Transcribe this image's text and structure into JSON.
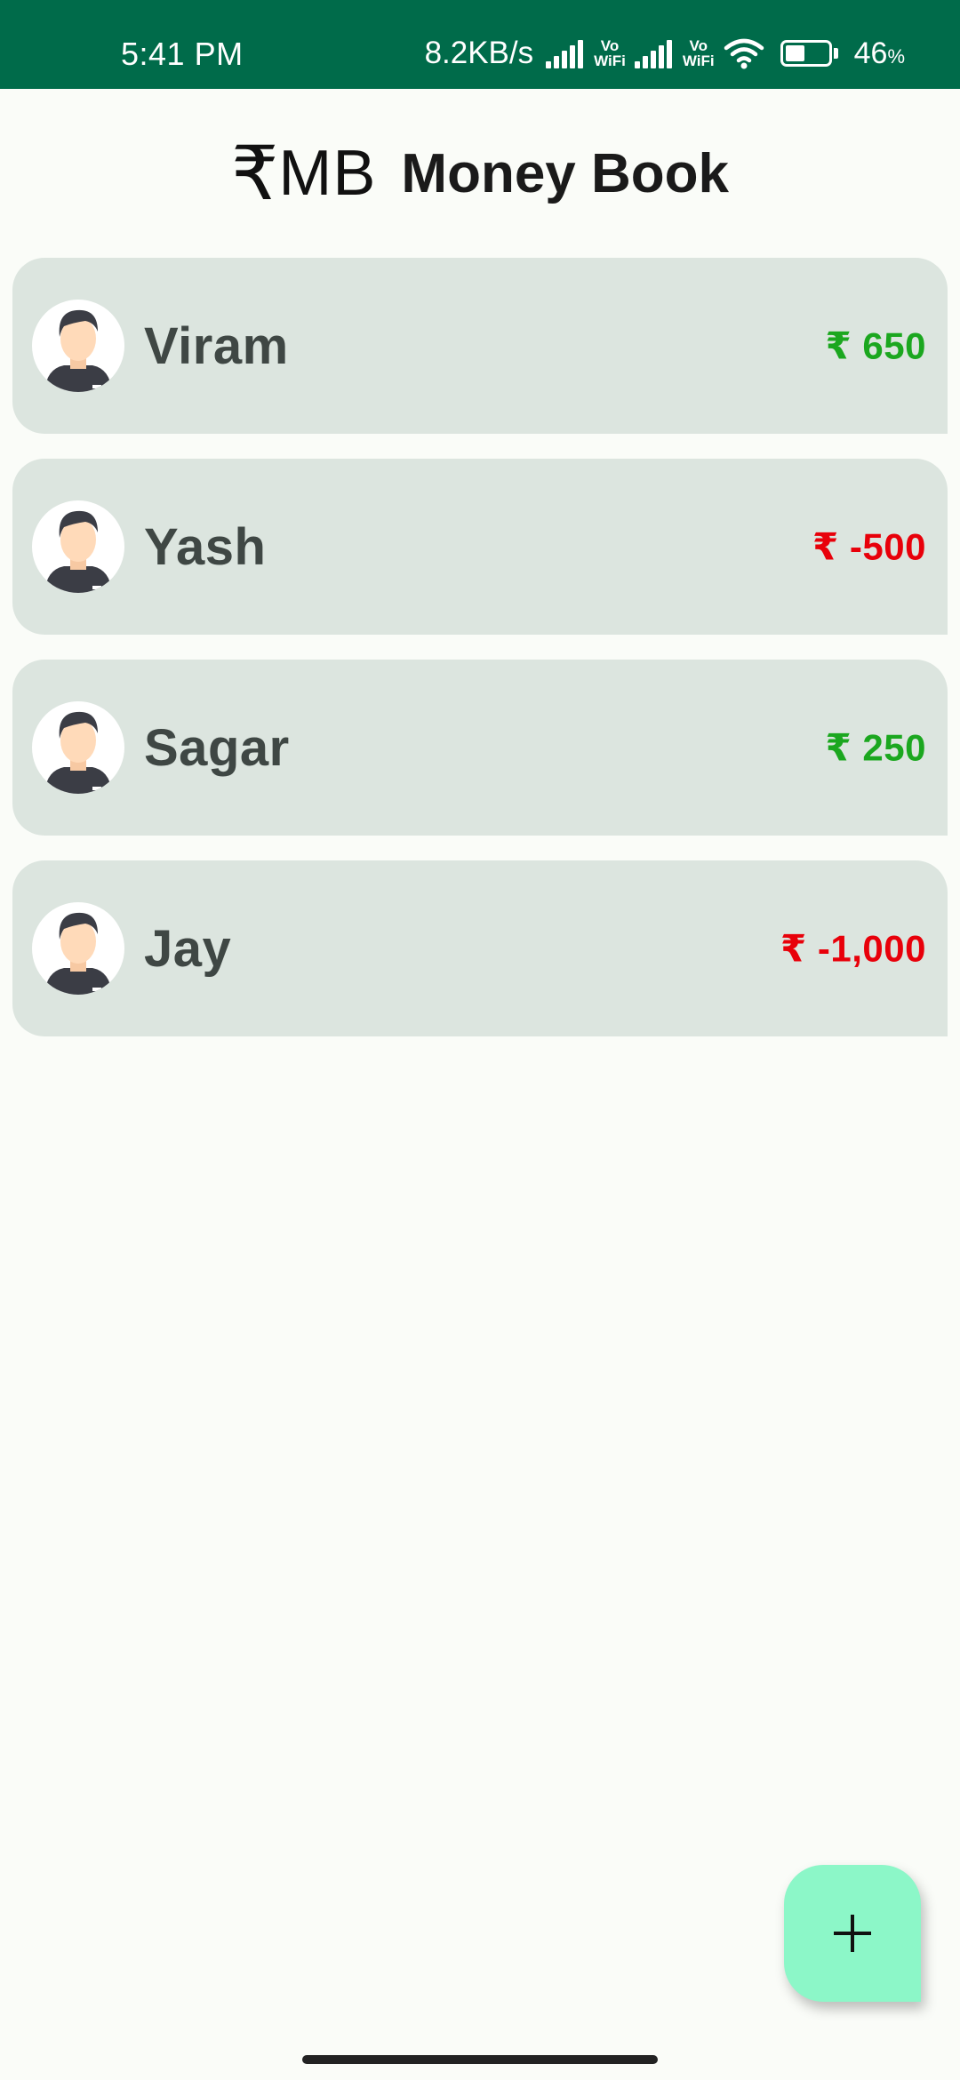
{
  "status_bar": {
    "time": "5:41 PM",
    "net_speed": "8.2KB/s",
    "vowifi_top": "Vo",
    "vowifi_bottom": "WiFi",
    "battery_level": "46",
    "battery_unit": "%",
    "battery_fraction": 0.46
  },
  "header": {
    "logo_symbol": "₹",
    "logo_text": "MB",
    "title": "Money Book"
  },
  "people": [
    {
      "name": "Viram",
      "amount": "₹ 650",
      "sign": "positive"
    },
    {
      "name": "Yash",
      "amount": "₹ -500",
      "sign": "negative"
    },
    {
      "name": "Sagar",
      "amount": "₹ 250",
      "sign": "positive"
    },
    {
      "name": "Jay",
      "amount": "₹ -1,000",
      "sign": "negative"
    }
  ],
  "icons": {
    "avatar": "person-avatar-icon",
    "fab": "plus-icon",
    "wifi": "wifi-icon",
    "signal": "signal-icon",
    "battery": "battery-icon"
  },
  "colors": {
    "status_bar": "#006B4A",
    "background": "#FAFCF8",
    "card": "#DCE5DF",
    "positive": "#1BA71F",
    "negative": "#E8000A",
    "fab": "#8CF7C8"
  }
}
